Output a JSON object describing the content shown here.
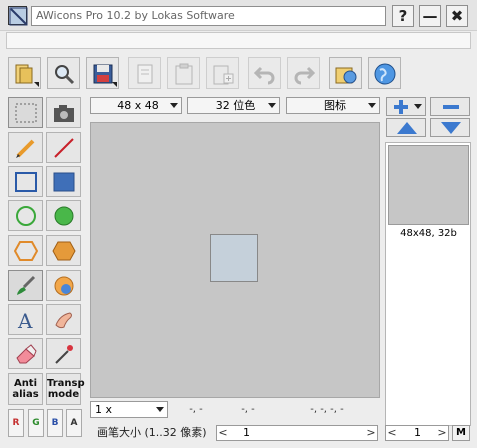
{
  "window": {
    "title": "AWicons Pro 10.2 by Lokas Software",
    "help_label": "?",
    "minimize_label": "—",
    "close_label": "✖"
  },
  "toolbar": {
    "buttons": [
      "open-folder",
      "zoom",
      "save",
      "copy-page",
      "paste",
      "paste-new",
      "undo",
      "redo",
      "open-file",
      "web"
    ]
  },
  "tools": {
    "antialias_line1": "Anti",
    "antialias_line2": "alias",
    "transparent_line1": "Transp",
    "transparent_line2": "mode"
  },
  "channels": [
    "R",
    "G",
    "B",
    "A"
  ],
  "canvas_options": {
    "size": "48 x 48",
    "color_depth": "32 位色",
    "type": "图标"
  },
  "status": {
    "zoom": "1 x",
    "coord1": "-, -",
    "coord2": "-, -",
    "coord3": "-, -, -, -"
  },
  "brush": {
    "label": "画笔大小 (1..32 像素)",
    "value": "1"
  },
  "right_panel": {
    "thumbnail_label": "48x48, 32b",
    "page_value": "1",
    "m_label": "M"
  }
}
